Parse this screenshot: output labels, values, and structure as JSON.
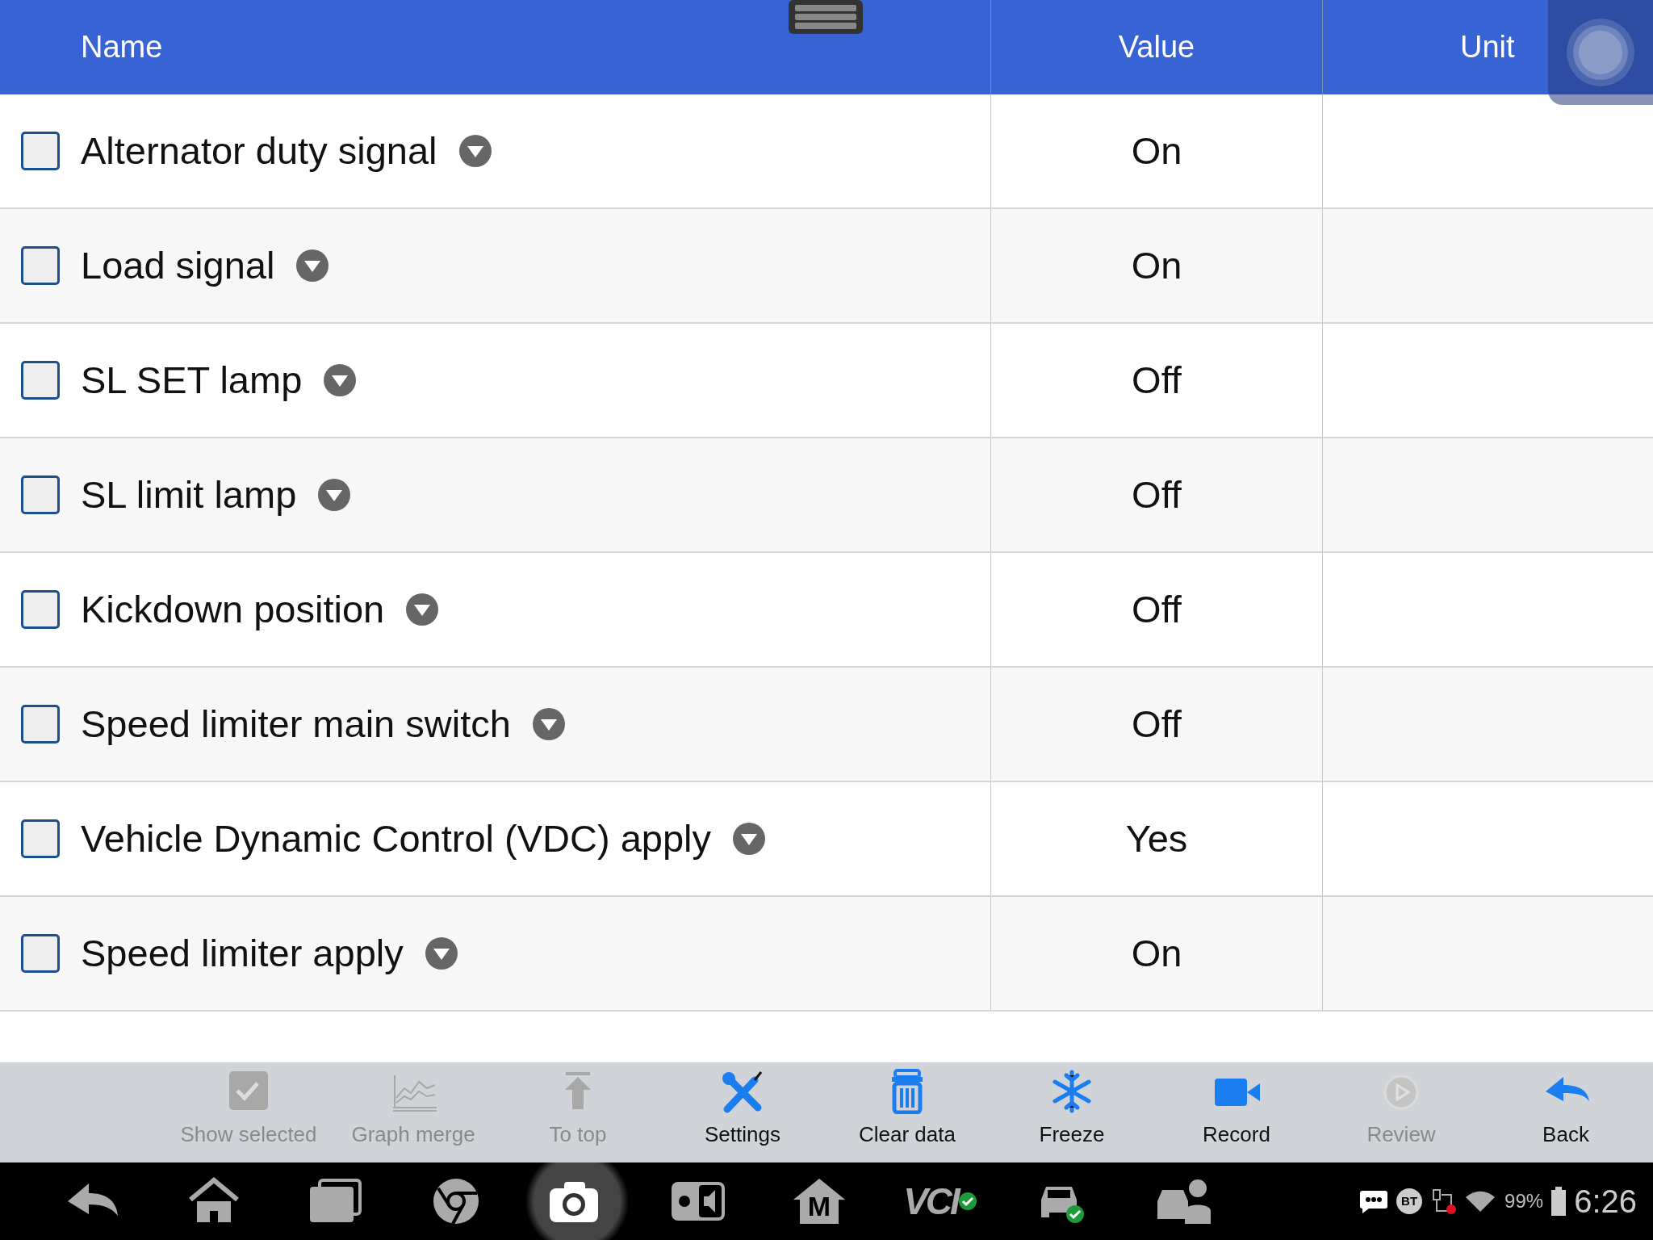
{
  "table": {
    "columns": [
      "Name",
      "Value",
      "Unit"
    ],
    "rows": [
      {
        "name": "Alternator duty signal",
        "value": "On",
        "checked": false
      },
      {
        "name": "Load signal",
        "value": "On",
        "checked": false
      },
      {
        "name": "SL SET lamp",
        "value": "Off",
        "checked": false
      },
      {
        "name": "SL limit lamp",
        "value": "Off",
        "checked": false
      },
      {
        "name": "Kickdown position",
        "value": "Off",
        "checked": false
      },
      {
        "name": "Speed limiter main switch",
        "value": "Off",
        "checked": false
      },
      {
        "name": "Vehicle Dynamic Control (VDC) apply",
        "value": "Yes",
        "checked": false
      },
      {
        "name": "Speed limiter apply",
        "value": "On",
        "checked": false
      }
    ]
  },
  "toolbar": [
    {
      "kind": "check",
      "label": "Show selected",
      "disabled": true
    },
    {
      "kind": "graph",
      "label": "Graph merge",
      "disabled": true
    },
    {
      "kind": "top",
      "label": "To top",
      "disabled": true
    },
    {
      "kind": "tools",
      "label": "Settings",
      "disabled": false
    },
    {
      "kind": "trash",
      "label": "Clear data",
      "disabled": false
    },
    {
      "kind": "snow",
      "label": "Freeze",
      "disabled": false
    },
    {
      "kind": "video",
      "label": "Record",
      "disabled": false
    },
    {
      "kind": "play",
      "label": "Review",
      "disabled": true
    },
    {
      "kind": "back",
      "label": "Back",
      "disabled": false
    }
  ],
  "system_bar": {
    "m_label": "M",
    "vci_label": "VCI",
    "bt_label": "BT",
    "battery": "99%",
    "time": "6:26"
  }
}
